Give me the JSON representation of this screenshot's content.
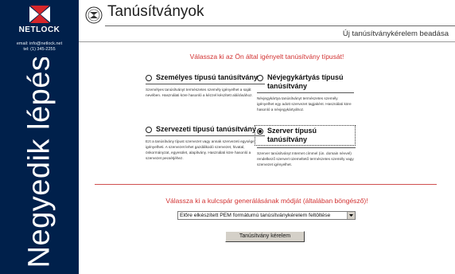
{
  "sidebar": {
    "logo_text": "NETLOCK",
    "email": "email: info@netlock.net",
    "tel": "tel: (1) 345-2255",
    "step_title": "Negyedik lépés"
  },
  "header": {
    "title": "Tanúsítványok",
    "subtitle": "Új tanúsítványkérelem beadása"
  },
  "main": {
    "prompt_cert_type": "Válassza ki az Ön által igényelt tanúsítvány típusát!",
    "options": [
      {
        "title": "Személyes típusú tanúsítvány",
        "description": "Személyes tanúsítványt természetes személy igényelhet a saját nevében. Használati köre hasonló a kézzel készített aláírásához.",
        "selected": false
      },
      {
        "title": "Névjegykártyás típusú tanúsítvány",
        "description": "Névjegykártya tanúsítványt természetes személy igényelhet egy adott szervezet tagjaként. Használati köre hasonló a névjegykártyához.",
        "selected": false
      },
      {
        "title": "Szervezeti típusú tanúsítvány",
        "description": "Ezt a tanúsítvány típust szervezet vagy annak szervezeti egysége igényelheti. A szervezet lehet gazdálkodó szervezet, hivatal, önkormányzat, egyesület, alapítvány. Használati köre hasonló a szervezet pecsétjéhez.",
        "selected": false
      },
      {
        "title": "Szerver típusú tanúsítvány",
        "description": "Szerver tanúsítványt Internet címmel (ún. domain névvel) rendelkező szervert üzemeltető természetes személy vagy szervezet igényelhet.",
        "selected": true
      }
    ],
    "prompt_keygen": "Válassza ki a kulcspár generálásának módját (általában böngésző)!",
    "keygen_select_value": "Előre elkészített PEM formátumú tanúsítványkérelem feltöltése",
    "submit_label": "Tanúsítvány kérelem"
  }
}
